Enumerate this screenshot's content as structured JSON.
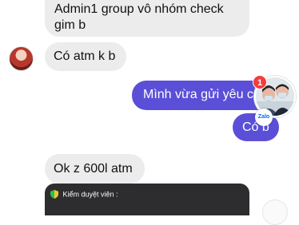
{
  "messages": [
    {
      "direction": "incoming",
      "text": "Admin1 group vô nhóm check gim b"
    },
    {
      "direction": "incoming",
      "text": "Có atm k b"
    },
    {
      "direction": "outgoing",
      "text": "Mình vừa gửi yêu c"
    },
    {
      "direction": "outgoing",
      "text": "Có b"
    },
    {
      "direction": "incoming",
      "text": "Ok z 600l atm"
    }
  ],
  "notice_card": {
    "label": "Kiểm duyệt viên :"
  },
  "unread_badge": "1",
  "zalo_badge": "Zalo",
  "colors": {
    "outgoing_bubble": "#5b4fd8",
    "incoming_bubble": "#ececed",
    "notice_card": "#2d2d30",
    "unread_badge": "#f03d3d",
    "zalo_brand": "#0068ff"
  },
  "icons": {
    "unread": "badge-count-icon",
    "zalo": "zalo-logo-icon",
    "moderator": "green-shield-icon"
  }
}
